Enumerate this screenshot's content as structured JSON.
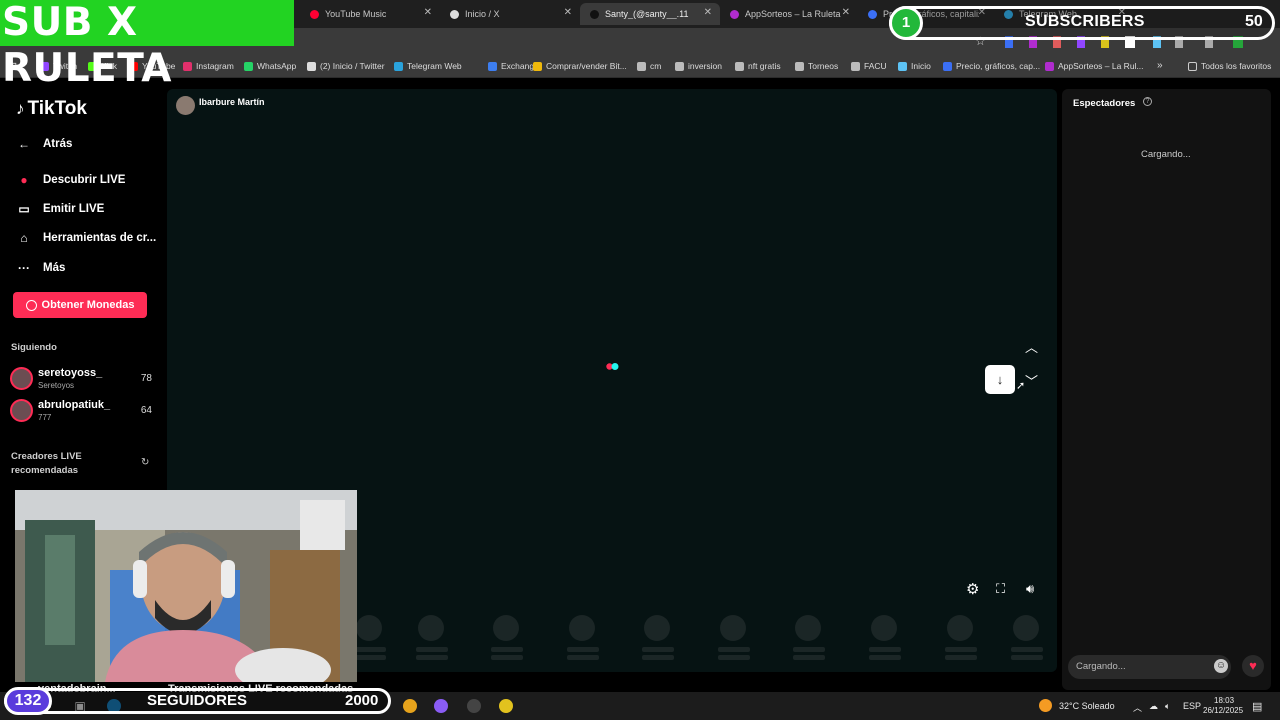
{
  "browser": {
    "tabs": [
      {
        "title": "YouTube Music",
        "color": "#ff0033"
      },
      {
        "title": "Inicio / X",
        "color": "#dddddd"
      },
      {
        "title": "Santy_(@santy__.11",
        "color": "#111111",
        "active": true
      },
      {
        "title": "AppSorteos – La Ruleta d",
        "color": "#b02ccf"
      },
      {
        "title": "Precio, gráficos, capitaliz",
        "color": "#3b6ff5"
      },
      {
        "title": "Telegram Web",
        "color": "#2aa3dd"
      }
    ],
    "bookmarks": [
      {
        "label": "Twitch",
        "color": "#9146ff"
      },
      {
        "label": "Kick",
        "color": "#53fc18"
      },
      {
        "label": "YouTube",
        "color": "#ff0000"
      },
      {
        "label": "Instagram",
        "color": "#e1306c"
      },
      {
        "label": "WhatsApp",
        "color": "#25d366"
      },
      {
        "label": "(2) Inicio / Twitter",
        "color": "#dddddd"
      },
      {
        "label": "Telegram Web",
        "color": "#2aa3dd"
      },
      {
        "label": "Exchange",
        "color": "#3d7ef0"
      },
      {
        "label": "Comprar/vender Bit...",
        "color": "#f0b90b"
      },
      {
        "label": "cm",
        "color": "#bbbbbb"
      },
      {
        "label": "inversion",
        "color": "#bbbbbb"
      },
      {
        "label": "nft gratis",
        "color": "#bbbbbb"
      },
      {
        "label": "Torneos",
        "color": "#bbbbbb"
      },
      {
        "label": "FACU",
        "color": "#bbbbbb"
      },
      {
        "label": "Inicio",
        "color": "#5dc3f5"
      },
      {
        "label": "Precio, gráficos, cap...",
        "color": "#3b6ff5"
      },
      {
        "label": "AppSorteos – La Rul...",
        "color": "#b02ccf"
      }
    ],
    "all_bookmarks": "Todos los favoritos"
  },
  "overlay": {
    "title": "SUB X RULETA",
    "subs_current": "1",
    "subs_label": "SUBSCRIBERS",
    "subs_goal": "50",
    "followers_current": "132",
    "followers_label": "SEGUIDORES",
    "followers_goal": "2000"
  },
  "tiktok": {
    "logo": "TikTok",
    "nav": [
      {
        "label": "Atrás",
        "icon": "back-arrow-icon",
        "glyph": "←"
      },
      {
        "label": "Descubrir LIVE",
        "icon": "live-avatar-icon",
        "glyph": "●"
      },
      {
        "label": "Emitir LIVE",
        "icon": "video-camera-icon",
        "glyph": "▭"
      },
      {
        "label": "Herramientas de cr...",
        "icon": "home-tools-icon",
        "glyph": "⌂"
      },
      {
        "label": "Más",
        "icon": "more-dots-icon",
        "glyph": "···"
      }
    ],
    "coins_button": "Obtener Monedas",
    "following_label": "Siguiendo",
    "following": [
      {
        "name": "seretoyoss_",
        "sub": "Seretoyos",
        "count": "78"
      },
      {
        "name": "abrulopatiuk_",
        "sub": "777",
        "count": "64"
      }
    ],
    "recommended_label_1": "Creadores LIVE",
    "recommended_label_2": "recomendadas",
    "under_item_1": "ventadebrain...",
    "under_item_2": "Transmisiones LIVE recomendadas",
    "host_name": "Ibarbure Martín",
    "spectators_title": "Espectadores",
    "loading": "Cargando...",
    "chat_placeholder": "Cargando..."
  },
  "taskbar": {
    "weather": "32°C  Soleado",
    "lang": "ESP",
    "time": "18:03",
    "date": "26/12/2025"
  }
}
